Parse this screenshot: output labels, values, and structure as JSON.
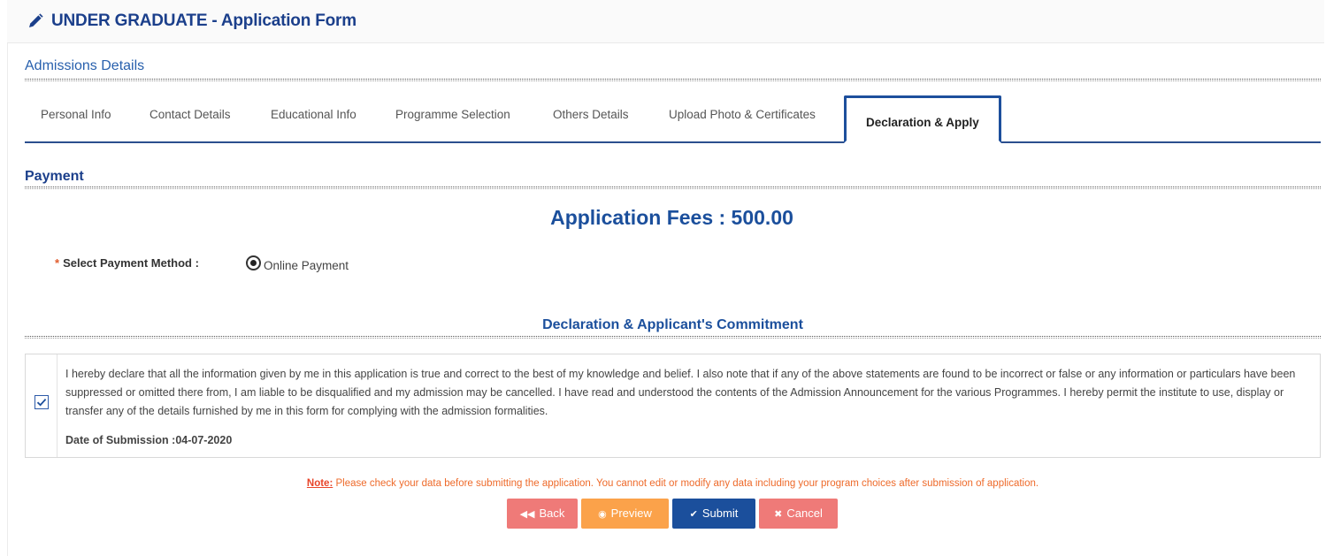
{
  "header": {
    "icon": "pencil-icon",
    "title": "UNDER GRADUATE - Application Form"
  },
  "section": {
    "subtitle": "Admissions Details"
  },
  "tabs": [
    {
      "label": "Personal Info"
    },
    {
      "label": "Contact Details"
    },
    {
      "label": "Educational Info"
    },
    {
      "label": "Programme Selection"
    },
    {
      "label": "Others Details"
    },
    {
      "label": "Upload Photo & Certificates"
    },
    {
      "label": "Declaration & Apply",
      "active": true
    }
  ],
  "payment": {
    "heading": "Payment",
    "fees": "Application Fees : 500.00",
    "method_label": "Select Payment Method :",
    "required_mark": "*",
    "method_option": "Online Payment",
    "method_selected": true
  },
  "declaration": {
    "heading": "Declaration & Applicant's Commitment",
    "checked": true,
    "text": "I hereby declare that all the information given by me in this application is true and correct to the best of my knowledge and belief. I also note that if any of the above statements are found to be incorrect or false or any information or particulars have been suppressed or omitted there from, I am liable to be disqualified and my admission may be cancelled. I have read and understood the contents of the Admission Announcement for the various Programmes. I hereby permit the institute to use, display or transfer any of the details furnished by me in this form for complying with the admission formalities.",
    "date_label": "Date of Submission :",
    "date_value": "04-07-2020"
  },
  "note": {
    "label": "Note:",
    "text": "Please check your data before submitting the application. You cannot edit or modify any data including your program choices after submission of application."
  },
  "buttons": {
    "back": {
      "label": "Back",
      "icon": "backward-icon"
    },
    "preview": {
      "label": "Preview",
      "icon": "eye-icon"
    },
    "submit": {
      "label": "Submit",
      "icon": "check-icon"
    },
    "cancel": {
      "label": "Cancel",
      "icon": "times-icon"
    }
  },
  "colors": {
    "primary": "#1b4f9c",
    "title": "#1b3f8b",
    "back": "#ef7a78",
    "preview": "#fba24a",
    "cancel": "#ef7a78",
    "note": "#ee6a2a"
  }
}
